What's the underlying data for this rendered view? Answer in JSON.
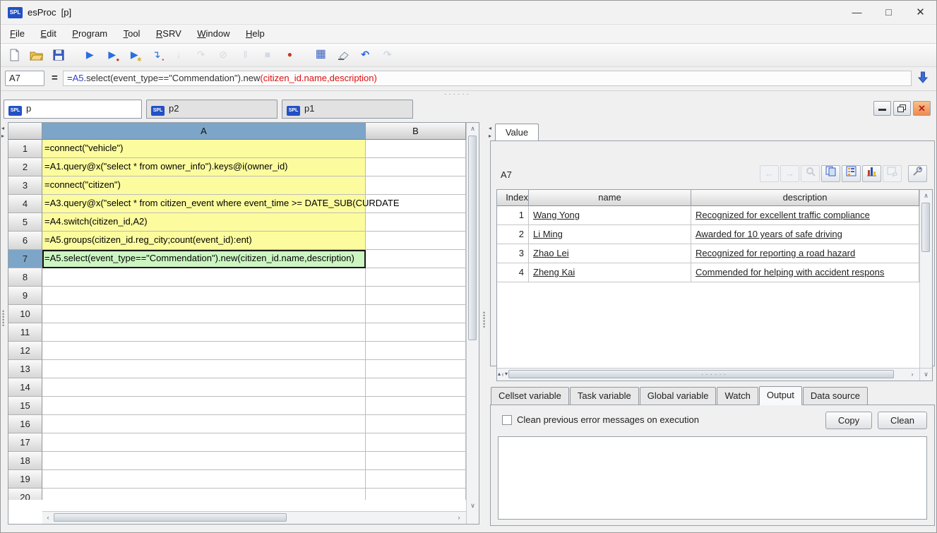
{
  "app": {
    "badge": "SPL"
  },
  "window": {
    "title": "esProc  [p]",
    "controls": {
      "minimize": "—",
      "maximize": "□",
      "close": "✕"
    }
  },
  "menu": {
    "items": [
      {
        "label": "File"
      },
      {
        "label": "Edit"
      },
      {
        "label": "Program"
      },
      {
        "label": "Tool"
      },
      {
        "label": "RSRV"
      },
      {
        "label": "Window"
      },
      {
        "label": "Help"
      }
    ]
  },
  "toolbar": {
    "icons": [
      "new-file",
      "open-file",
      "save",
      "run",
      "debug-run",
      "run-to-cursor",
      "step-over",
      "step-into",
      "step-return",
      "cancel",
      "pause",
      "stop",
      "breakpoint",
      "calculator",
      "clear-cache",
      "undo",
      "redo"
    ]
  },
  "formula_bar": {
    "cell_ref": "A7",
    "equals": "=",
    "p1": "=",
    "p2": "A5",
    "p3": ".select(event_type==\"Commendation\").new",
    "p4": "(citizen_id.name,description)"
  },
  "doc_tabs": [
    {
      "label": "p",
      "active": true
    },
    {
      "label": "p2",
      "active": false
    },
    {
      "label": "p1",
      "active": false
    }
  ],
  "grid": {
    "col_headers": [
      "A",
      "B"
    ],
    "selected_cell": "A7",
    "rows": [
      {
        "num": "1",
        "a": "=connect(\"vehicle\")"
      },
      {
        "num": "2",
        "a": "=A1.query@x(\"select * from owner_info\").keys@i(owner_id)"
      },
      {
        "num": "3",
        "a": "=connect(\"citizen\")"
      },
      {
        "num": "4",
        "a": "=A3.query@x(\"select * from citizen_event where event_time >= DATE_SUB(CURDATE"
      },
      {
        "num": "5",
        "a": "=A4.switch(citizen_id,A2)"
      },
      {
        "num": "6",
        "a": "=A5.groups(citizen_id.reg_city;count(event_id):ent)"
      },
      {
        "num": "7",
        "a": "=A5.select(event_type==\"Commendation\").new(citizen_id.name,description)"
      },
      {
        "num": "8",
        "a": ""
      },
      {
        "num": "9",
        "a": ""
      },
      {
        "num": "10",
        "a": ""
      },
      {
        "num": "11",
        "a": ""
      },
      {
        "num": "12",
        "a": ""
      },
      {
        "num": "13",
        "a": ""
      },
      {
        "num": "14",
        "a": ""
      },
      {
        "num": "15",
        "a": ""
      },
      {
        "num": "16",
        "a": ""
      },
      {
        "num": "17",
        "a": ""
      },
      {
        "num": "18",
        "a": ""
      },
      {
        "num": "19",
        "a": ""
      },
      {
        "num": "20",
        "a": ""
      }
    ]
  },
  "value_panel": {
    "tab_label": "Value",
    "cell_ref": "A7",
    "toolbar": [
      "back",
      "forward",
      "zoom",
      "copy",
      "record-view",
      "chart",
      "properties",
      "pin"
    ],
    "table": {
      "headers": [
        "Index",
        "name",
        "description"
      ],
      "rows": [
        {
          "index": "1",
          "name": "Wang Yong",
          "description": "Recognized for excellent traffic compliance"
        },
        {
          "index": "2",
          "name": "Li Ming",
          "description": "Awarded for 10 years of safe driving"
        },
        {
          "index": "3",
          "name": "Zhao Lei",
          "description": "Recognized for reporting a road hazard"
        },
        {
          "index": "4",
          "name": "Zheng Kai",
          "description": "Commended for helping with accident respons"
        }
      ]
    }
  },
  "bottom_panel": {
    "tabs": [
      {
        "label": "Cellset variable",
        "active": false
      },
      {
        "label": "Task variable",
        "active": false
      },
      {
        "label": "Global variable",
        "active": false
      },
      {
        "label": "Watch",
        "active": false
      },
      {
        "label": "Output",
        "active": true
      },
      {
        "label": "Data source",
        "active": false
      }
    ],
    "checkbox_label": "Clean previous error messages on execution",
    "copy_button": "Copy",
    "clean_button": "Clean"
  },
  "colors": {
    "accent_blue": "#2251c5",
    "cell_yellow": "#fcfc9e",
    "cell_selected_green": "#ccf5c2",
    "header_selected_blue": "#7da5c8",
    "formula_red": "#dd1111",
    "formula_blue": "#3344cc",
    "close_button_orange": "#ef8a4e"
  }
}
